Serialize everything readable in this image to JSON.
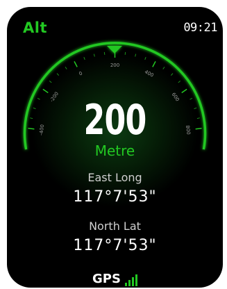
{
  "header": {
    "app_title": "Alt",
    "time": "09:21"
  },
  "dial": {
    "tick_labels": [
      "-400",
      "-200",
      "0",
      "200",
      "400",
      "600",
      "800"
    ],
    "current_value": 200,
    "min": -400,
    "max": 800,
    "color": "#22c822",
    "pointer_icon": "triangle-down-icon"
  },
  "altitude": {
    "value": "200",
    "unit": "Metre"
  },
  "longitude": {
    "label": "East Long",
    "value": "117°7'53\""
  },
  "latitude": {
    "label": "North Lat",
    "value": "117°7'53\""
  },
  "gps": {
    "label": "GPS",
    "signal_bars": 4,
    "signal_icon": "signal-bars-icon"
  }
}
